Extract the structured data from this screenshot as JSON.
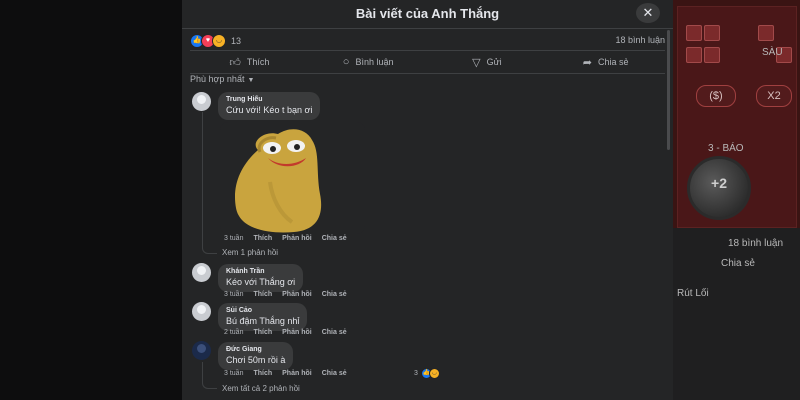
{
  "background": {
    "right_buttons": [
      "($)",
      "X2"
    ],
    "chip_label": "+2",
    "labels": {
      "top": "SÀU",
      "mid": "3 - BÁO",
      "comment_count": "18 bình luận",
      "share": "Chia sẻ",
      "reply": "Rút Lối"
    }
  },
  "modal": {
    "title": "Bài viết của Anh Thắng",
    "close_icon": "close-icon"
  },
  "reactions": {
    "count": "13",
    "comments": "18 bình luận",
    "icons": [
      "like-icon",
      "love-icon",
      "haha-icon"
    ]
  },
  "actions": [
    {
      "label": "Thích",
      "icon": "like-outline-icon"
    },
    {
      "label": "Bình luận",
      "icon": "comment-icon"
    },
    {
      "label": "Gửi",
      "icon": "send-icon"
    },
    {
      "label": "Chia sẻ",
      "icon": "share-icon"
    }
  ],
  "sort": {
    "label": "Phù hợp nhất"
  },
  "comments": [
    {
      "name": "Trung Hiếu",
      "text": "Cứu với! Kéo t bạn ơi",
      "time": "3 tuần",
      "like": "Thích",
      "reply": "Phản hồi",
      "share": "Chia sẻ",
      "view_replies": "Xem 1 phản hồi"
    },
    {
      "name": "Khánh Trần",
      "text": "Kéo với Thắng ơi",
      "time": "3 tuần",
      "like": "Thích",
      "reply": "Phản hồi",
      "share": "Chia sẻ"
    },
    {
      "name": "Sủi Cảo",
      "text": "Bú đậm Thắng nhỉ",
      "time": "2 tuần",
      "like": "Thích",
      "reply": "Phản hồi",
      "share": "Chia sẻ"
    },
    {
      "name": "Đức Giang",
      "text": "Chơi 50m rồi à",
      "time": "3 tuần",
      "like": "Thích",
      "reply": "Phản hồi",
      "share": "Chia sẻ",
      "reaction_count": "3",
      "view_replies": "Xem tất cả 2 phản hồi"
    }
  ],
  "colors": {
    "modal_bg": "#242526",
    "bubble_bg": "#3a3b3c",
    "text": "#e4e6eb",
    "muted": "#b0b3b8",
    "like_blue": "#1877f2"
  }
}
